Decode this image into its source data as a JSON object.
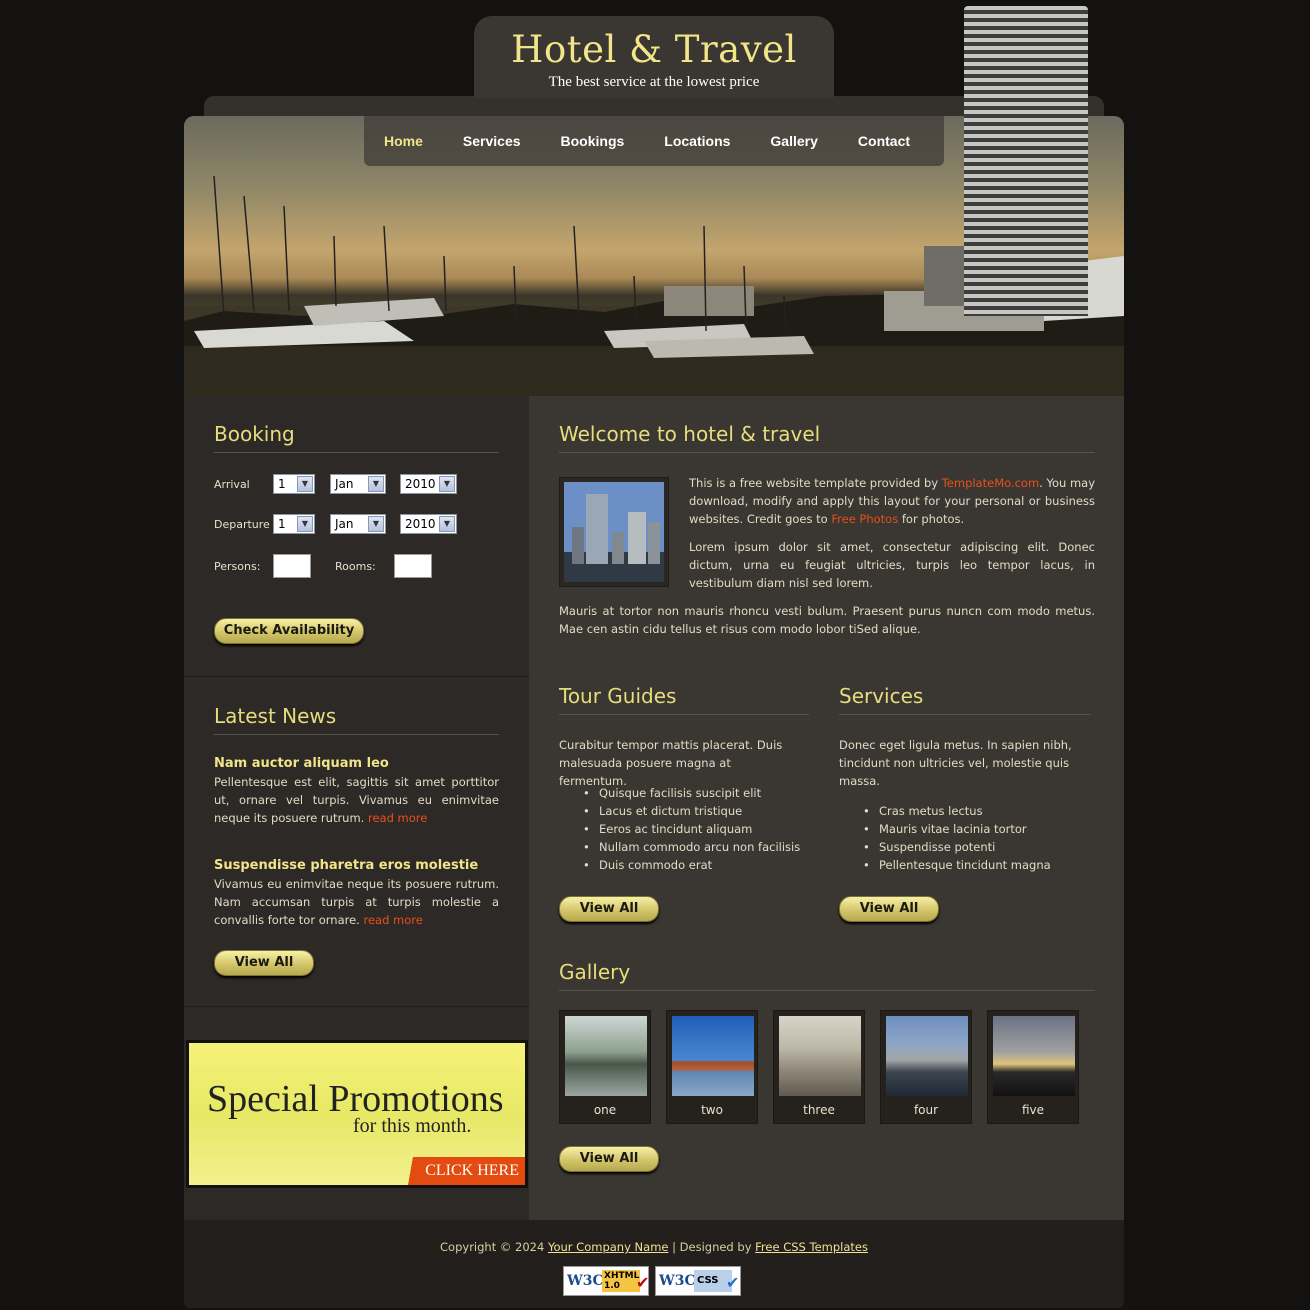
{
  "site": {
    "title": "Hotel & Travel",
    "tagline": "The best service at the lowest price"
  },
  "nav": {
    "items": [
      "Home",
      "Services",
      "Bookings",
      "Locations",
      "Gallery",
      "Contact"
    ],
    "active": "Home"
  },
  "booking": {
    "heading": "Booking",
    "arrival_label": "Arrival",
    "departure_label": "Departure",
    "arrival": {
      "day": "1",
      "month": "Jan",
      "year": "2010"
    },
    "departure": {
      "day": "1",
      "month": "Jan",
      "year": "2010"
    },
    "persons_label": "Persons:",
    "rooms_label": "Rooms:",
    "button": "Check Availability"
  },
  "news": {
    "heading": "Latest News",
    "items": [
      {
        "title": "Nam auctor aliquam leo",
        "body": "Pellentesque est elit, sagittis sit amet porttitor ut, ornare vel turpis. Vivamus eu enimvitae neque its posuere rutrum.",
        "more": "read more"
      },
      {
        "title": "Suspendisse pharetra eros molestie",
        "body": "Vivamus eu enimvitae neque its posuere rutrum. Nam accumsan turpis at turpis molestie a convallis forte tor ornare.",
        "more": "read more"
      }
    ],
    "view_all": "View All"
  },
  "promo": {
    "title": "Special Promotions",
    "subtitle": "for this month.",
    "cta": "CLICK HERE"
  },
  "welcome": {
    "heading": "Welcome to hotel & travel",
    "p1_a": "This is a free website template provided by ",
    "p1_link1": "TemplateMo.com",
    "p1_b": ". You may download, modify and apply this layout for your personal or business websites. Credit goes to ",
    "p1_link2": "Free Photos",
    "p1_c": " for photos.",
    "p2": "Lorem ipsum dolor sit amet, consectetur adipiscing elit. Donec dictum, urna eu feugiat ultricies, turpis leo tempor lacus, in vestibulum diam nisl sed lorem.",
    "p3": "Mauris at tortor non mauris rhoncu vesti bulum. Praesent purus nuncn com modo metus. Mae cen astin cidu tellus et risus com modo lobor tiSed alique."
  },
  "tour_guides": {
    "heading": "Tour Guides",
    "intro": "Curabitur tempor mattis placerat. Duis malesuada posuere magna at fermentum.",
    "items": [
      "Quisque facilisis suscipit elit",
      "Lacus et dictum tristique",
      "Eeros ac tincidunt aliquam",
      "Nullam commodo arcu non facilisis",
      "Duis commodo erat"
    ],
    "view_all": "View All"
  },
  "services": {
    "heading": "Services",
    "intro": "Donec eget ligula metus. In sapien nibh, tincidunt non ultricies vel, molestie quis massa.",
    "items": [
      "Cras metus lectus",
      "Mauris vitae lacinia tortor",
      "Suspendisse potenti",
      "Pellentesque tincidunt magna"
    ],
    "view_all": "View All"
  },
  "gallery": {
    "heading": "Gallery",
    "items": [
      "one",
      "two",
      "three",
      "four",
      "five"
    ],
    "view_all": "View All"
  },
  "footer": {
    "copy_a": "Copyright © 2024 ",
    "company": "Your Company Name",
    "sep": " | Designed by ",
    "designer": "Free CSS Templates",
    "badge1": "XHTML 1.0",
    "badge2": "CSS",
    "w3c": "W3C"
  },
  "colors": {
    "accent": "#f2e488",
    "link": "#e8501a",
    "background": "#141210",
    "panel": "#3a3632"
  }
}
